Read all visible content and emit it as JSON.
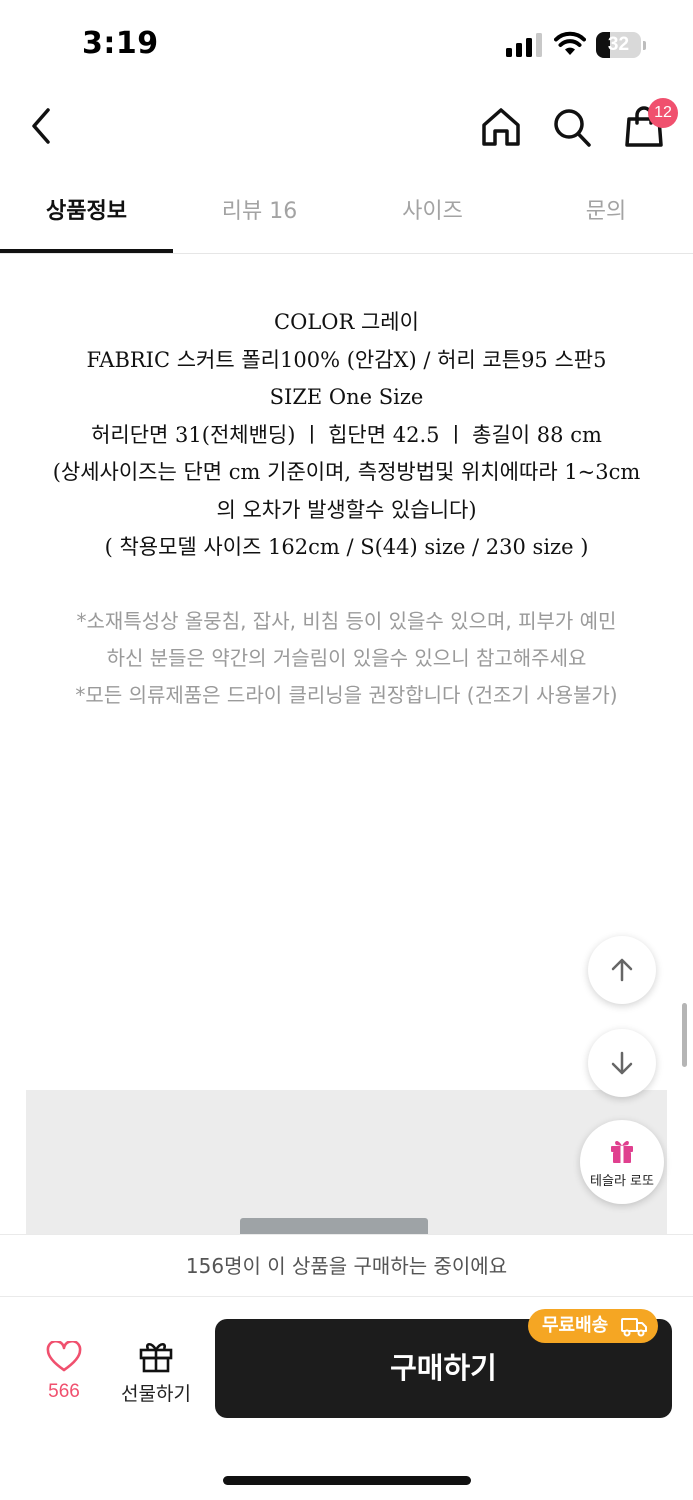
{
  "status_bar": {
    "time": "3:19",
    "battery": "32",
    "battery_level": 0.32
  },
  "top_nav": {
    "cart_count": "12"
  },
  "tabs": [
    {
      "label": "상품정보",
      "active": true
    },
    {
      "label": "리뷰 16",
      "active": false
    },
    {
      "label": "사이즈",
      "active": false
    },
    {
      "label": "문의",
      "active": false
    }
  ],
  "product_info": {
    "lines": [
      "COLOR 그레이",
      "FABRIC 스커트 폴리100% (안감X) / 허리 코튼95 스판5",
      "SIZE One Size",
      "허리단면 31(전체밴딩)  ㅣ  힙단면 42.5  ㅣ  총길이 88 cm",
      "(상세사이즈는 단면 cm 기준이며, 측정방법및 위치에따라 1~3cm",
      "의 오차가 발생할수 있습니다)",
      "( 착용모델 사이즈 162cm / S(44) size / 230 size )"
    ]
  },
  "notes": {
    "lines": [
      "*소재특성상 올뭉침, 잡사, 비침 등이 있을수 있으며, 피부가 예민",
      "하신 분들은 약간의 거슬림이 있을수 있으니 참고해주세요",
      "*모든 의류제품은 드라이 클리닝을 권장합니다 (건조기 사용불가)"
    ]
  },
  "float": {
    "lotto_label": "테슬라 로또"
  },
  "bottom": {
    "buying_text": "156명이 이 상품을 구매하는 중이에요",
    "like_count": "566",
    "gift_label": "선물하기",
    "buy_label": "구매하기",
    "free_shipping": "무료배송"
  },
  "colors": {
    "accent_pink": "#f0506e",
    "free_ship_orange": "#f5a623",
    "buy_button": "#1c1c1c"
  },
  "icons": [
    "back-icon",
    "home-icon",
    "search-icon",
    "cart-icon",
    "arrow-up-icon",
    "arrow-down-icon",
    "gift-icon",
    "heart-icon",
    "truck-icon"
  ]
}
